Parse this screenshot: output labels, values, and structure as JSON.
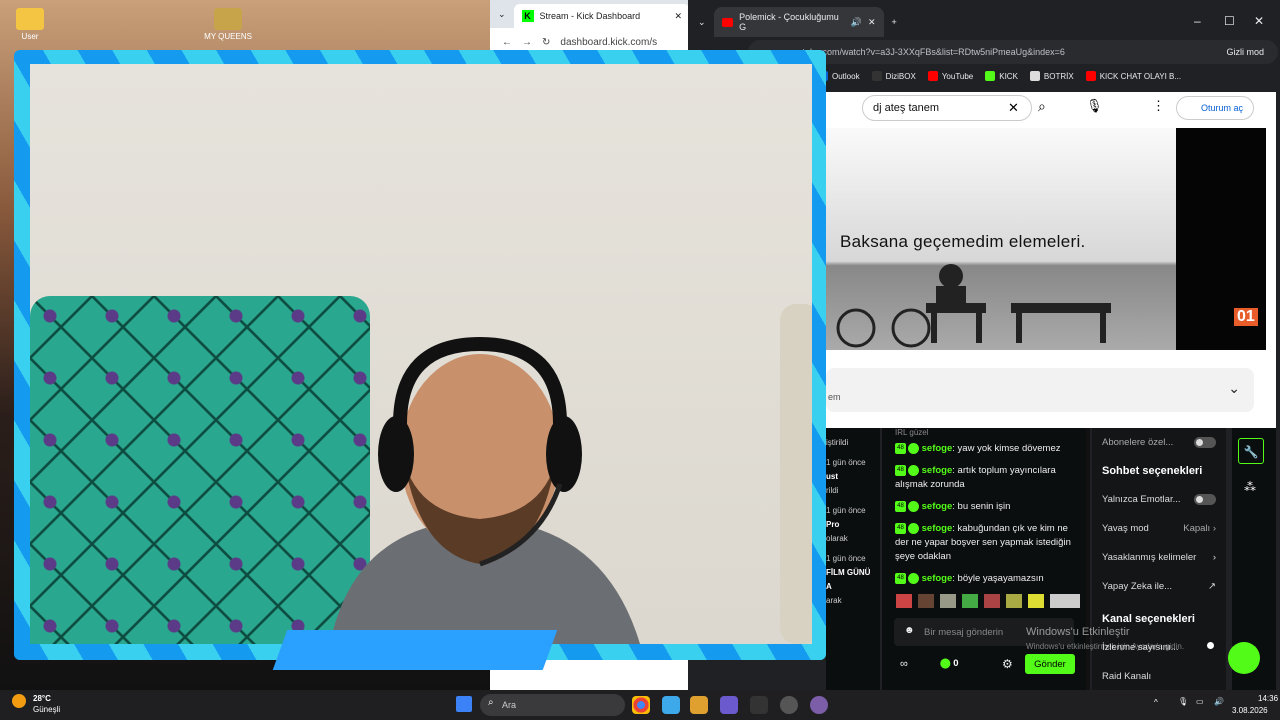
{
  "desktop": {
    "icons": [
      "User",
      "MY QUEENS"
    ]
  },
  "kick_window": {
    "tab_title": "Stream - Kick Dashboard",
    "url": "dashboard.kick.com/s"
  },
  "yt_window": {
    "tab_title": "Polemick - Çocukluğumu G",
    "url": "youtube.com/watch?v=a3J-3XXqFBs&list=RDtw5niPmeaUg&index=6",
    "incognito": "Gizli mod",
    "bookmarks": [
      "Outlook",
      "DiziBOX",
      "YouTube",
      "KICK",
      "BOTRİX",
      "KICK CHAT OLAYI B..."
    ]
  },
  "youtube": {
    "search_value": "dj ateş tanem",
    "signin": "Oturum aç",
    "caption": "Baksana geçemedim elemeleri.",
    "channel_badge": "01",
    "dropdown_text": "em"
  },
  "kick_left": {
    "items": [
      "iştirildi",
      "1 gün önce",
      "ust",
      "rildi",
      "1 gün önce",
      "Pro",
      "olarak",
      "1 gün önce",
      "FİLM GÜNÜ",
      "A",
      "arak"
    ]
  },
  "chat": {
    "top_text": "IRL güzel",
    "messages": [
      {
        "user": "sefoge",
        "text": "yaw yok kimse dövemez"
      },
      {
        "user": "sefoge",
        "text": "artık toplum yayıncılara alışmak zorunda"
      },
      {
        "user": "sefoge",
        "text": "bu senin işin"
      },
      {
        "user": "sefoge",
        "text": "kabuğundan çık ve kim ne der ne yapar boşver sen yapmak istediğin şeye odaklan"
      },
      {
        "user": "sefoge",
        "text": "böyle yaşayamazsın"
      }
    ],
    "input_placeholder": "Bir mesaj gönderin",
    "send_label": "Gönder",
    "points": "0"
  },
  "settings": {
    "top_row": "Abonelere özel...",
    "chat_section": "Sohbet seçenekleri",
    "rows": [
      {
        "label": "Yalnızca Emotlar...",
        "type": "toggle"
      },
      {
        "label": "Yavaş mod",
        "value": "Kapalı",
        "type": "arrow"
      },
      {
        "label": "Yasaklanmış kelimeler",
        "type": "arrow"
      },
      {
        "label": "Yapay Zeka ile...",
        "type": "link"
      }
    ],
    "channel_section": "Kanal seçenekleri",
    "channel_rows": [
      "İzlenme sayısını...",
      "Raid Kanalı"
    ]
  },
  "watermark": {
    "title": "Windows'u Etkinleştir",
    "sub": "Windows'u etkinleştirmek için Ayarlar'a gidin."
  },
  "taskbar": {
    "temp": "28°C",
    "weather": "Güneşli",
    "search_placeholder": "Ara",
    "time": "14:36",
    "date": "3.08.2026"
  }
}
